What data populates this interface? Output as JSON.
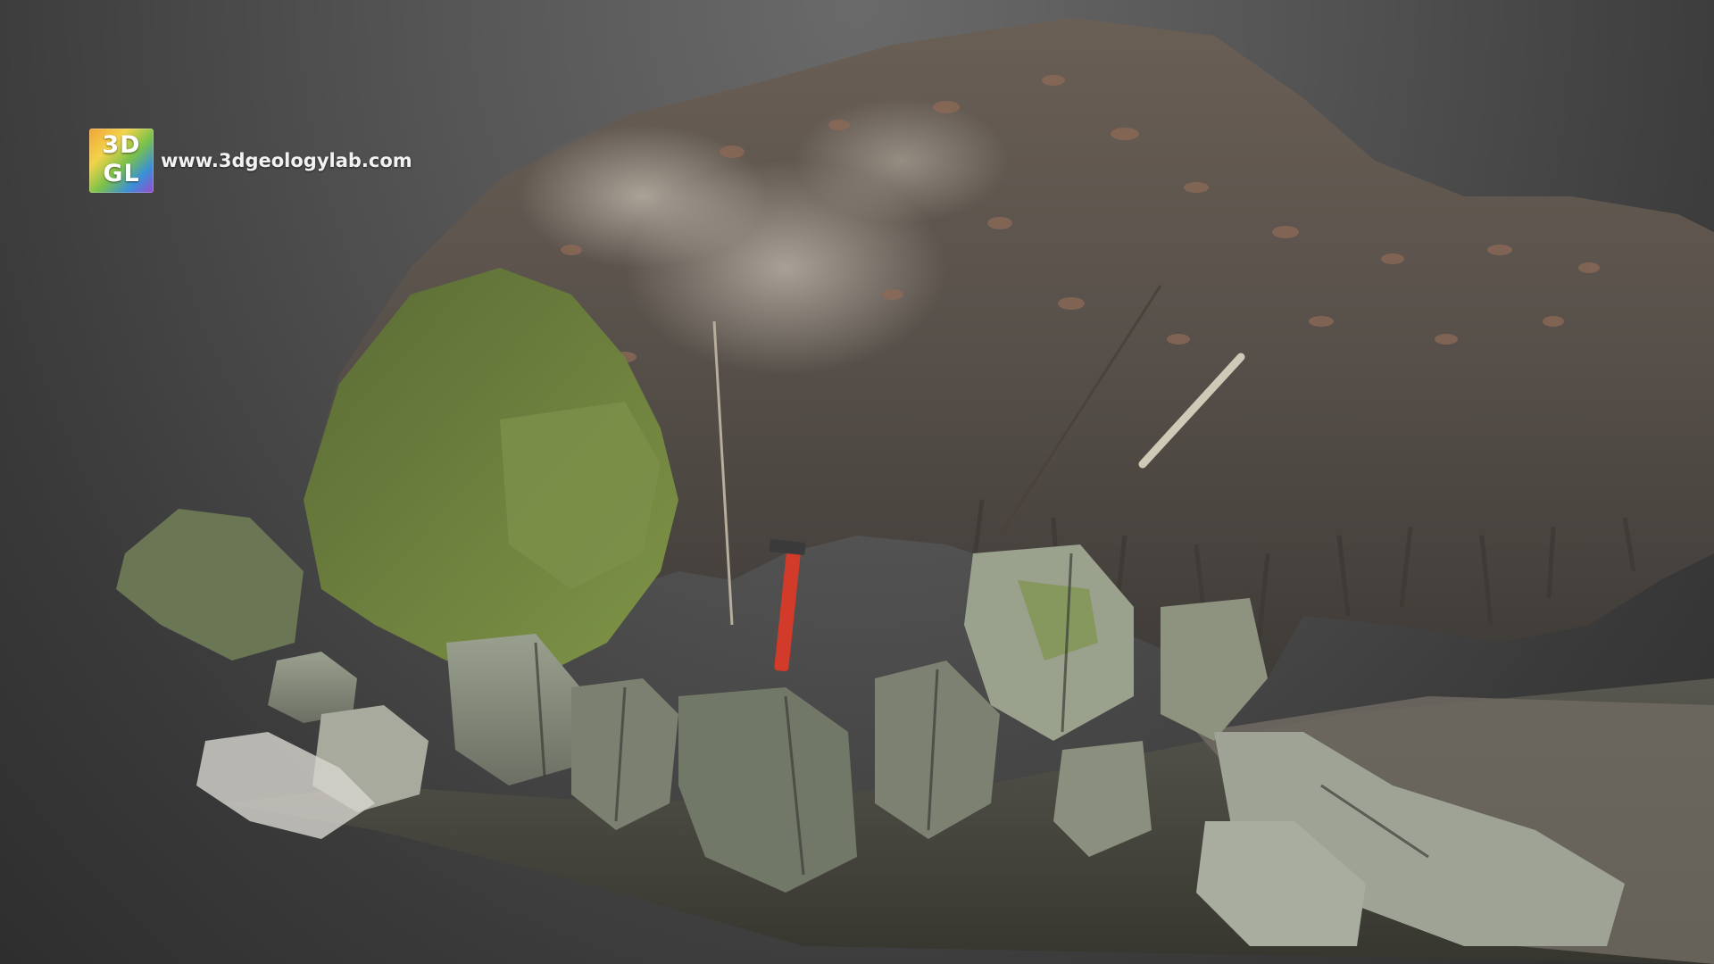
{
  "brand": {
    "logo_line1": "3D",
    "logo_line2": "GL",
    "url": "www.3dgeologylab.com"
  },
  "scene": {
    "subject": "3D photogrammetry model of rock outcrop",
    "colors": {
      "rock": "#8e9382",
      "moss": "#6f8a3a",
      "soil": "#5e5347",
      "leaves": "#8a6a55",
      "water": "#4a4a47",
      "hammer_handle": "#d23a2a"
    }
  }
}
